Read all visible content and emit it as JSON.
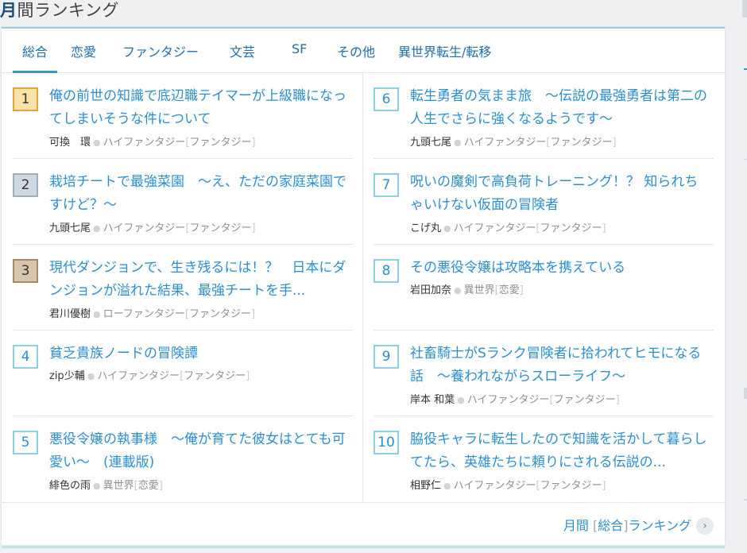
{
  "heading": {
    "first": "月",
    "rest": "間ランキング"
  },
  "tabs": [
    "総合",
    "恋愛",
    "ファンタジー",
    "文芸",
    "SF",
    "その他",
    "異世界転生/転移"
  ],
  "items": [
    {
      "rank": "1",
      "title": "俺の前世の知識で底辺職テイマーが上級職になってしまいそうな件について",
      "author": "可換　環",
      "genre": "ハイファンタジー",
      "category": "ファンタジー"
    },
    {
      "rank": "2",
      "title": "栽培チートで最強菜園　～え、ただの家庭菜園ですけど？～",
      "author": "九頭七尾",
      "genre": "ハイファンタジー",
      "category": "ファンタジー"
    },
    {
      "rank": "3",
      "title": "現代ダンジョンで、生き残るには！？　日本にダンジョンが溢れた結果、最強チートを手...",
      "author": "君川優樹",
      "genre": "ローファンタジー",
      "category": "ファンタジー"
    },
    {
      "rank": "4",
      "title": "貧乏貴族ノードの冒険譚",
      "author": "zip少輔",
      "genre": "ハイファンタジー",
      "category": "ファンタジー"
    },
    {
      "rank": "5",
      "title": "悪役令嬢の執事様　～俺が育てた彼女はとても可愛い～　(連載版)",
      "author": "緋色の雨",
      "genre": "異世界",
      "category": "恋愛"
    },
    {
      "rank": "6",
      "title": "転生勇者の気まま旅　～伝説の最強勇者は第二の人生でさらに強くなるようです～",
      "author": "九頭七尾",
      "genre": "ハイファンタジー",
      "category": "ファンタジー"
    },
    {
      "rank": "7",
      "title": "呪いの魔剣で高負荷トレーニング！？ 知られちゃいけない仮面の冒険者",
      "author": "こげ丸",
      "genre": "ハイファンタジー",
      "category": "ファンタジー"
    },
    {
      "rank": "8",
      "title": "その悪役令嬢は攻略本を携えている",
      "author": "岩田加奈",
      "genre": "異世界",
      "category": "恋愛"
    },
    {
      "rank": "9",
      "title": "社畜騎士がSランク冒険者に拾われてヒモになる話　～養われながらスローライフ～",
      "author": "岸本 和葉",
      "genre": "ハイファンタジー",
      "category": "ファンタジー"
    },
    {
      "rank": "10",
      "title": "脇役キャラに転生したので知識を活かして暮らしてたら、英雄たちに頼りにされる伝説の...",
      "author": "相野仁",
      "genre": "ハイファンタジー",
      "category": "ファンタジー"
    }
  ],
  "more_link": {
    "part1": "月間",
    "part2": "総合",
    "part3": "ランキング"
  },
  "colors": {
    "accent": "#2b8fcf",
    "gold": "#fce2a8",
    "silver": "#cfd9e2",
    "bronze": "#d9c6ae"
  }
}
